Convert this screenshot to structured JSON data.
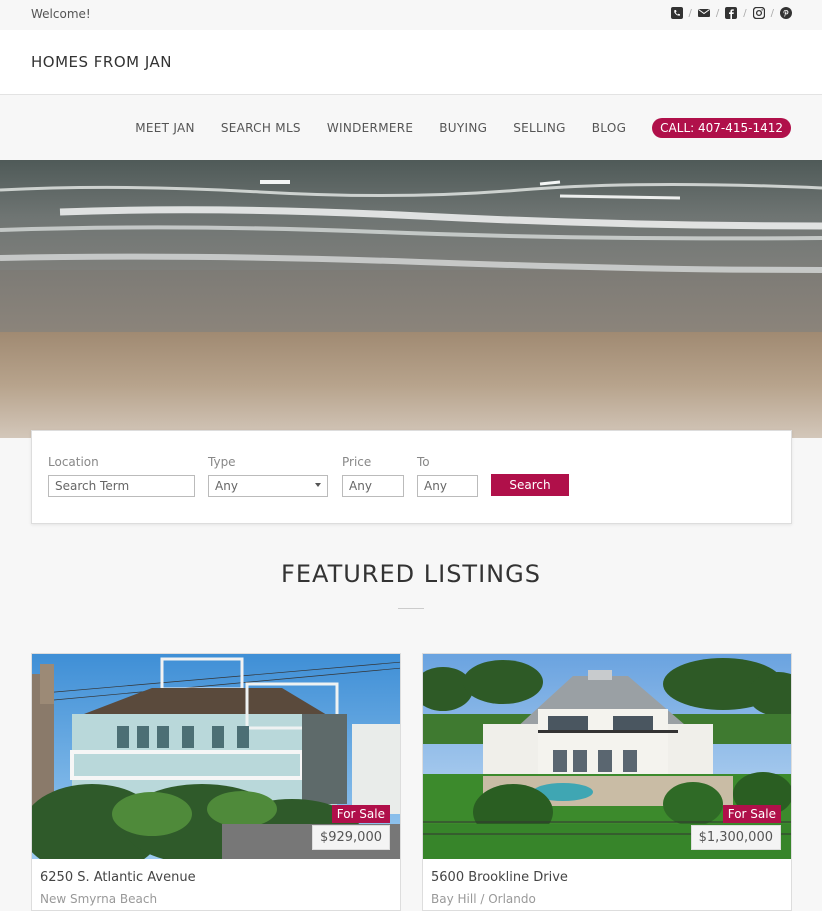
{
  "topbar": {
    "welcome": "Welcome!",
    "icons": [
      "phone-icon",
      "envelope-icon",
      "facebook-icon",
      "instagram-icon",
      "pinterest-icon"
    ],
    "separator": "/"
  },
  "brand": "HOMES FROM JAN",
  "nav": {
    "items": [
      "MEET JAN",
      "SEARCH MLS",
      "WINDERMERE",
      "BUYING",
      "SELLING",
      "BLOG"
    ],
    "call": "CALL: 407-415-1412"
  },
  "search": {
    "location_label": "Location",
    "location_placeholder": "Search Term",
    "type_label": "Type",
    "type_value": "Any",
    "price_label": "Price",
    "price_value": "Any",
    "to_label": "To",
    "to_value": "Any",
    "button": "Search"
  },
  "featured": {
    "title": "FEATURED LISTINGS",
    "listings": [
      {
        "status": "For Sale",
        "price": "$929,000",
        "address": "6250 S. Atlantic Avenue",
        "city": "New Smyrna Beach"
      },
      {
        "status": "For Sale",
        "price": "$1,300,000",
        "address": "5600 Brookline Drive",
        "city": "Bay Hill / Orlando"
      }
    ]
  },
  "colors": {
    "accent": "#b0104a",
    "background": "#f7f7f7"
  }
}
